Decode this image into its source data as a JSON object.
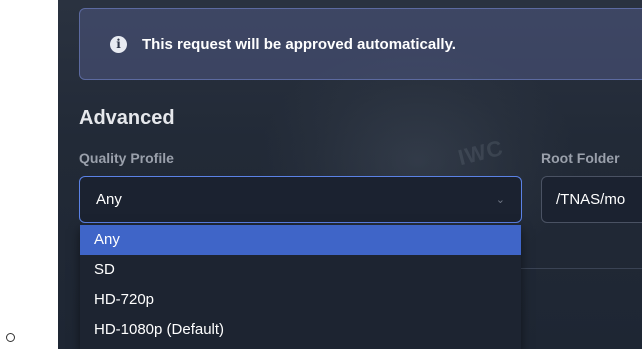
{
  "notice": {
    "icon": "info-icon",
    "text": "This request will be approved automatically."
  },
  "advanced": {
    "title": "Advanced",
    "quality_profile": {
      "label": "Quality Profile",
      "selected": "Any",
      "options": [
        "Any",
        "SD",
        "HD-720p",
        "HD-1080p (Default)"
      ]
    },
    "root_folder": {
      "label": "Root Folder",
      "value": "/TNAS/mo"
    }
  },
  "colors": {
    "accent": "#3f65c8",
    "notice_border": "#5c6aa0",
    "modal_bg": "#222a37"
  }
}
